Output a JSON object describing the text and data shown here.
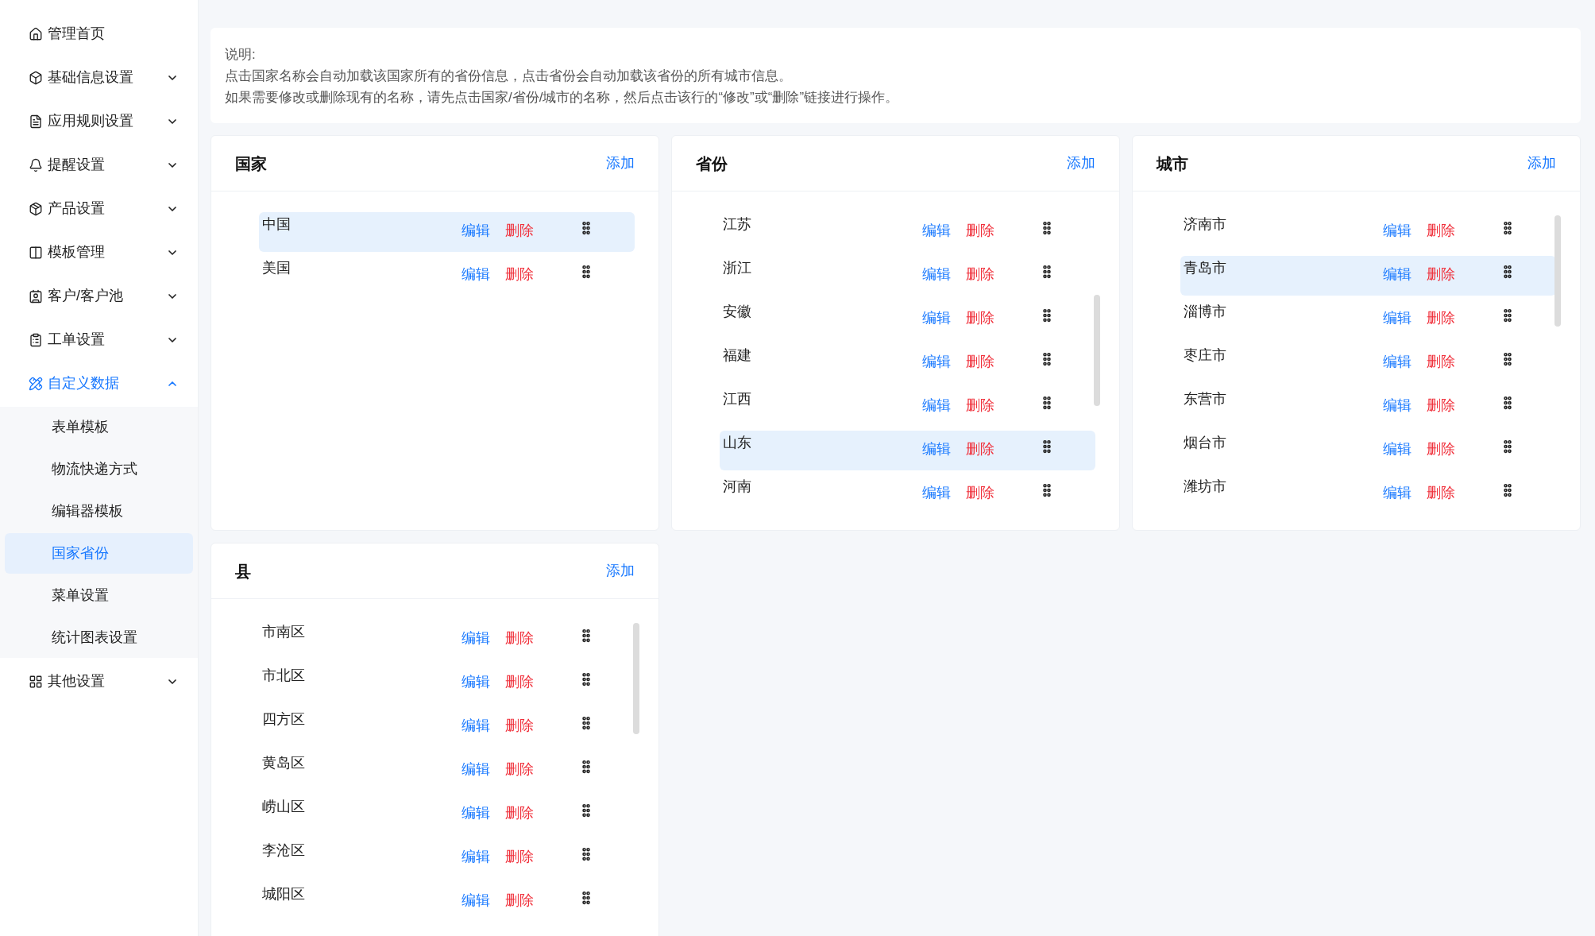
{
  "sidebar": {
    "items": [
      {
        "label": "管理首页",
        "selected": false
      },
      {
        "label": "基础信息设置",
        "selected": false,
        "expanded": false
      },
      {
        "label": "应用规则设置",
        "selected": false,
        "expanded": false
      },
      {
        "label": "提醒设置",
        "selected": false,
        "expanded": false
      },
      {
        "label": "产品设置",
        "selected": false,
        "expanded": false
      },
      {
        "label": "模板管理",
        "selected": false,
        "expanded": false
      },
      {
        "label": "客户/客户池",
        "selected": false,
        "expanded": false
      },
      {
        "label": "工单设置",
        "selected": false,
        "expanded": false
      },
      {
        "label": "自定义数据",
        "selected": true,
        "expanded": true,
        "children": [
          {
            "label": "表单模板",
            "selected": false
          },
          {
            "label": "物流快递方式",
            "selected": false
          },
          {
            "label": "编辑器模板",
            "selected": false
          },
          {
            "label": "国家省份",
            "selected": true
          },
          {
            "label": "菜单设置",
            "selected": false
          },
          {
            "label": "统计图表设置",
            "selected": false
          }
        ]
      },
      {
        "label": "其他设置",
        "selected": false,
        "expanded": false
      }
    ]
  },
  "note": {
    "title": "说明:",
    "lines": [
      "点击国家名称会自动加载该国家所有的省份信息，点击省份会自动加载该省份的所有城市信息。",
      "如果需要修改或删除现有的名称，请先点击国家/省份/城市的名称，然后点击该行的“修改”或“删除”链接进行操作。"
    ]
  },
  "panels": [
    {
      "title": "国家",
      "add": "添加",
      "rows": [
        {
          "name": "中国",
          "selected": true,
          "edit": "编辑",
          "delete": "删除"
        },
        {
          "name": "美国",
          "selected": false,
          "edit": "编辑",
          "delete": "删除"
        }
      ]
    },
    {
      "title": "省份",
      "add": "添加",
      "rows": [
        {
          "name": "江苏",
          "selected": false,
          "edit": "编辑",
          "delete": "删除"
        },
        {
          "name": "浙江",
          "selected": false,
          "edit": "编辑",
          "delete": "删除"
        },
        {
          "name": "安徽",
          "selected": false,
          "edit": "编辑",
          "delete": "删除"
        },
        {
          "name": "福建",
          "selected": false,
          "edit": "编辑",
          "delete": "删除"
        },
        {
          "name": "江西",
          "selected": false,
          "edit": "编辑",
          "delete": "删除"
        },
        {
          "name": "山东",
          "selected": true,
          "edit": "编辑",
          "delete": "删除"
        },
        {
          "name": "河南",
          "selected": false,
          "edit": "编辑",
          "delete": "删除"
        }
      ]
    },
    {
      "title": "城市",
      "add": "添加",
      "rows": [
        {
          "name": "济南市",
          "selected": false,
          "edit": "编辑",
          "delete": "删除"
        },
        {
          "name": "青岛市",
          "selected": true,
          "edit": "编辑",
          "delete": "删除"
        },
        {
          "name": "淄博市",
          "selected": false,
          "edit": "编辑",
          "delete": "删除"
        },
        {
          "name": "枣庄市",
          "selected": false,
          "edit": "编辑",
          "delete": "删除"
        },
        {
          "name": "东营市",
          "selected": false,
          "edit": "编辑",
          "delete": "删除"
        },
        {
          "name": "烟台市",
          "selected": false,
          "edit": "编辑",
          "delete": "删除"
        },
        {
          "name": "潍坊市",
          "selected": false,
          "edit": "编辑",
          "delete": "删除"
        }
      ]
    },
    {
      "title": "县",
      "add": "添加",
      "rows": [
        {
          "name": "市南区",
          "selected": false,
          "edit": "编辑",
          "delete": "删除"
        },
        {
          "name": "市北区",
          "selected": false,
          "edit": "编辑",
          "delete": "删除"
        },
        {
          "name": "四方区",
          "selected": false,
          "edit": "编辑",
          "delete": "删除"
        },
        {
          "name": "黄岛区",
          "selected": false,
          "edit": "编辑",
          "delete": "删除"
        },
        {
          "name": "崂山区",
          "selected": false,
          "edit": "编辑",
          "delete": "删除"
        },
        {
          "name": "李沧区",
          "selected": false,
          "edit": "编辑",
          "delete": "删除"
        },
        {
          "name": "城阳区",
          "selected": false,
          "edit": "编辑",
          "delete": "删除"
        }
      ]
    }
  ]
}
